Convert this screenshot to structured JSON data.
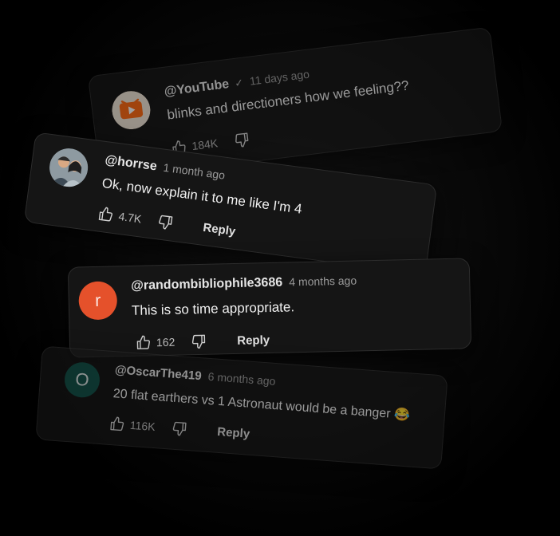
{
  "comments": [
    {
      "handle": "@YouTube",
      "verified_mark": "✓",
      "time": "11 days ago",
      "text": "blinks and directioners how we feeling??",
      "likes": "184K",
      "reply_label": "",
      "avatar_icon": "youtube-logo-icon",
      "avatar_color": "#ff7a1a"
    },
    {
      "handle": "@horrse",
      "time": "1 month ago",
      "text": "Ok, now explain it to me like I'm 4",
      "likes": "4.7K",
      "reply_label": "Reply",
      "avatar_icon": "couple-photo-icon"
    },
    {
      "handle": "@randombibliophile3686",
      "time": "4 months ago",
      "text": "This is so time appropriate.",
      "likes": "162",
      "reply_label": "Reply",
      "avatar_letter": "r",
      "avatar_color": "#e5512b"
    },
    {
      "handle": "@OscarThe419",
      "time": "6 months ago",
      "text": "20 flat earthers vs 1 Astronaut would be a banger 😂",
      "likes": "116K",
      "reply_label": "Reply",
      "avatar_letter": "O",
      "avatar_color": "#14534a"
    }
  ],
  "icons": {
    "like": "thumbs-up-icon",
    "dislike": "thumbs-down-icon"
  }
}
